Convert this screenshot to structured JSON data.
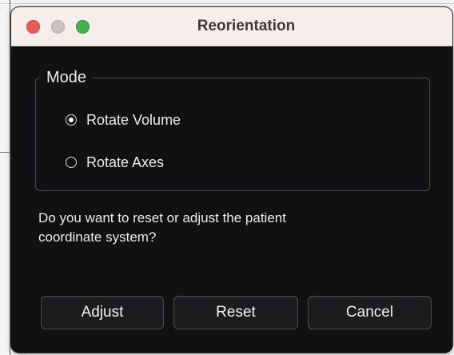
{
  "window": {
    "title": "Reorientation",
    "controls": [
      "close",
      "minimize",
      "zoom"
    ]
  },
  "mode_group": {
    "title": "Mode",
    "options": [
      {
        "label": "Rotate Volume",
        "selected": true
      },
      {
        "label": "Rotate Axes",
        "selected": false
      }
    ]
  },
  "prompt": {
    "line1": "Do you want to reset or adjust the patient",
    "line2": "coordinate system?"
  },
  "buttons": {
    "adjust": "Adjust",
    "reset": "Reset",
    "cancel": "Cancel"
  },
  "colors": {
    "titlebar": "#f5eeea",
    "background": "#111113",
    "close": "#ed5b57",
    "minimize": "#c7c4c2",
    "zoom": "#3fb54a"
  }
}
